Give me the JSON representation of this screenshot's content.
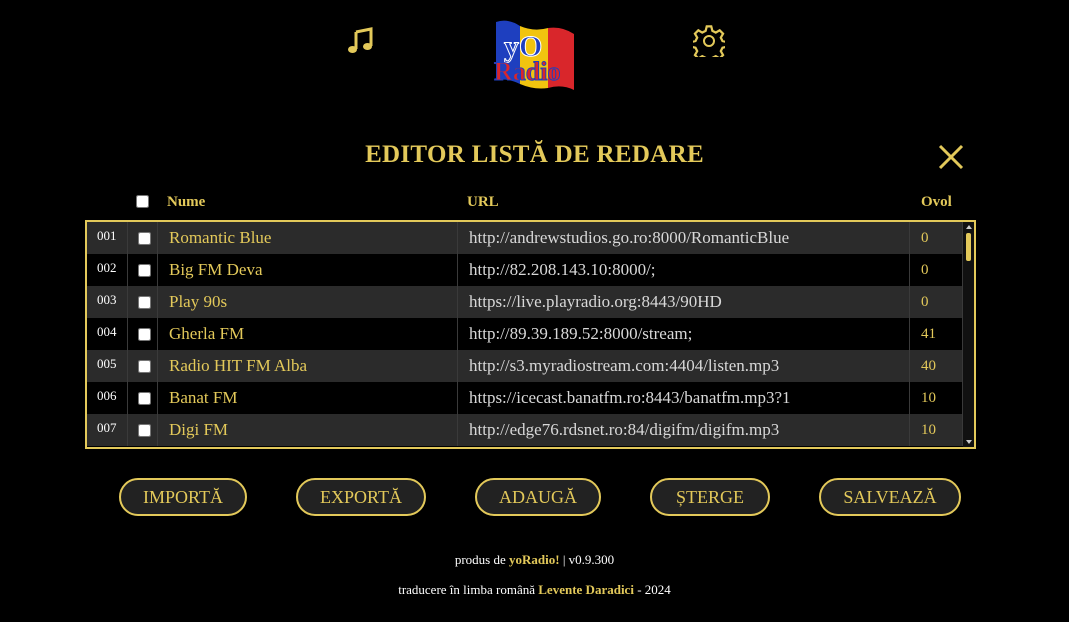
{
  "header": {
    "logo_text_top": "yO",
    "logo_text_bottom": "Radio"
  },
  "editor": {
    "title": "EDITOR LISTĂ DE REDARE",
    "columns": {
      "name": "Nume",
      "url": "URL",
      "ovol": "Ovol"
    },
    "rows": [
      {
        "num": "001",
        "name": "Romantic Blue",
        "url": "http://andrewstudios.go.ro:8000/RomanticBlue",
        "ovol": "0"
      },
      {
        "num": "002",
        "name": "Big FM Deva",
        "url": "http://82.208.143.10:8000/;",
        "ovol": "0"
      },
      {
        "num": "003",
        "name": "Play 90s",
        "url": "https://live.playradio.org:8443/90HD",
        "ovol": "0"
      },
      {
        "num": "004",
        "name": "Gherla FM",
        "url": "http://89.39.189.52:8000/stream;",
        "ovol": "41"
      },
      {
        "num": "005",
        "name": "Radio HIT FM Alba",
        "url": "http://s3.myradiostream.com:4404/listen.mp3",
        "ovol": "40"
      },
      {
        "num": "006",
        "name": "Banat FM",
        "url": "https://icecast.banatfm.ro:8443/banatfm.mp3?1",
        "ovol": "10"
      },
      {
        "num": "007",
        "name": "Digi FM",
        "url": "http://edge76.rdsnet.ro:84/digifm/digifm.mp3",
        "ovol": "10"
      }
    ]
  },
  "buttons": {
    "import": "IMPORTĂ",
    "export": "EXPORTĂ",
    "add": "ADAUGĂ",
    "delete": "ȘTERGE",
    "save": "SALVEAZĂ"
  },
  "footer": {
    "line1_prefix": "produs de ",
    "line1_brand": "yoRadio!",
    "line1_version": " | v0.9.300",
    "line2_prefix": "traducere în limba română ",
    "line2_author": "Levente Daradici",
    "line2_suffix": " - 2024"
  },
  "icons": {
    "music": "music-note-icon",
    "settings": "gear-icon",
    "close": "close-icon"
  },
  "colors": {
    "accent": "#e3c95a",
    "background": "#000000",
    "row_alt": "#2b2b2b"
  }
}
